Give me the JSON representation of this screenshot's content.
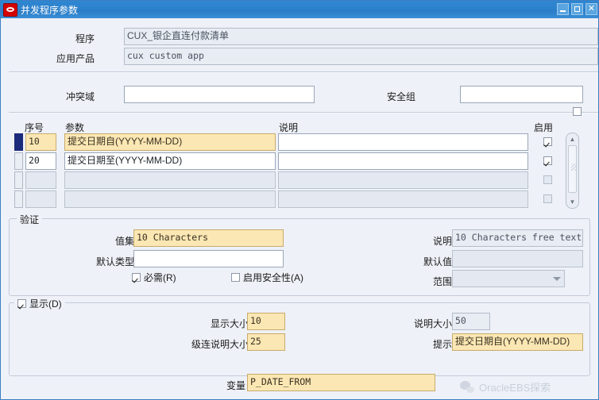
{
  "window": {
    "title": "并发程序参数",
    "logo_icon": "oracle-logo-icon",
    "minimize_label": "",
    "maximize_label": "",
    "close_label": "✕"
  },
  "header": {
    "program_label": "程序",
    "program_value": "CUX_银企直连付款清单",
    "application_label": "应用产品",
    "application_value": "cux custom app",
    "conflict_domain_label": "冲突域",
    "conflict_domain_value": "",
    "security_group_label": "安全组",
    "security_group_value": ""
  },
  "table": {
    "columns": [
      "序号",
      "参数",
      "说明",
      "启用"
    ],
    "rows": [
      {
        "seq": "10",
        "parameter": "提交日期自(YYYY-MM-DD)",
        "description": "",
        "enabled": true,
        "selected": true
      },
      {
        "seq": "20",
        "parameter": "提交日期至(YYYY-MM-DD)",
        "description": "",
        "enabled": true,
        "selected": false
      },
      {
        "seq": "",
        "parameter": "",
        "description": "",
        "enabled": false,
        "selected": false
      },
      {
        "seq": "",
        "parameter": "",
        "description": "",
        "enabled": false,
        "selected": false
      }
    ],
    "header_checkbox_checked": false,
    "scroll_up_icon": "chevron-up-icon",
    "scroll_down_icon": "chevron-down-icon"
  },
  "validation": {
    "title": "验证",
    "value_set_label": "值集",
    "value_set_value": "10 Characters",
    "default_type_label": "默认类型",
    "default_type_value": "",
    "required_label": "必需(R)",
    "required_checked": true,
    "enable_security_label": "启用安全性(A)",
    "enable_security_checked": false,
    "description_label": "说明",
    "description_value": "10 Characters free text",
    "default_value_label": "默认值",
    "default_value_value": "",
    "range_label": "范围",
    "range_value": ""
  },
  "display": {
    "title": "显示(D)",
    "title_checked": true,
    "display_size_label": "显示大小",
    "display_size_value": "10",
    "concat_desc_size_label": "级连说明大小",
    "concat_desc_size_value": "25",
    "desc_size_label": "说明大小",
    "desc_size_value": "50",
    "prompt_label": "提示",
    "prompt_value": "提交日期自(YYYY-MM-DD)"
  },
  "footer": {
    "token_label": "变量",
    "token_value": "P_DATE_FROM"
  },
  "watermark": {
    "text": "OracleEBS探索",
    "icon": "wechat-icon"
  }
}
